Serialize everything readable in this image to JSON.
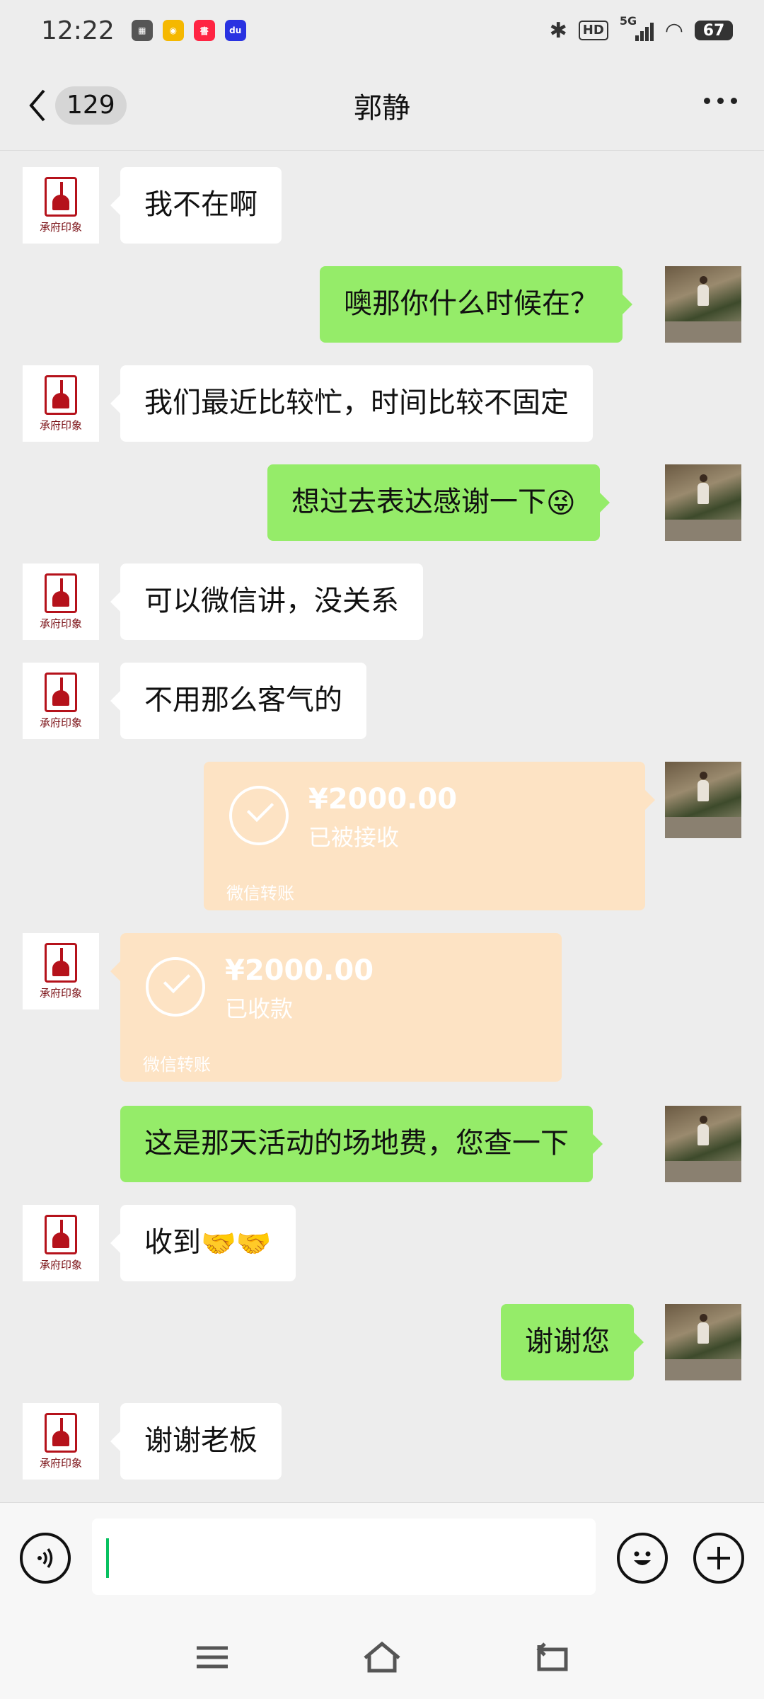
{
  "status_bar": {
    "time": "12:22",
    "network": "5G",
    "hd": "HD",
    "battery": "67"
  },
  "header": {
    "back_count": "129",
    "title": "郭静"
  },
  "messages": [
    {
      "side": "left",
      "text": "我不在啊"
    },
    {
      "side": "right",
      "text": "噢那你什么时候在？"
    },
    {
      "side": "left",
      "text": "我们最近比较忙，时间比较不固定"
    },
    {
      "side": "right",
      "text": "想过去表达感谢一下",
      "emoji": "😜"
    },
    {
      "side": "left",
      "text": "可以微信讲，没关系"
    },
    {
      "side": "left",
      "text": "不用那么客气的"
    },
    {
      "side": "right",
      "type": "transfer",
      "amount": "¥2000.00",
      "status": "已被接收",
      "label": "微信转账"
    },
    {
      "side": "left",
      "type": "transfer",
      "amount": "¥2000.00",
      "status": "已收款",
      "label": "微信转账"
    },
    {
      "side": "right",
      "text": "这是那天活动的场地费，您查一下"
    },
    {
      "side": "left",
      "text": "收到",
      "emoji": "🤝🤝"
    },
    {
      "side": "right",
      "text": "谢谢您"
    },
    {
      "side": "left",
      "text": "谢谢老板"
    }
  ],
  "avatar_left": {
    "logo_text": "承府印象"
  },
  "input": {
    "value": ""
  },
  "colors": {
    "sent_bubble": "#95ec69",
    "received_bubble": "#ffffff",
    "transfer": "#fde3c4",
    "background": "#ededed"
  },
  "icons": [
    "voice-icon",
    "emoji-icon",
    "plus-icon",
    "back-icon",
    "more-icon",
    "menu-icon",
    "home-icon",
    "return-icon"
  ]
}
